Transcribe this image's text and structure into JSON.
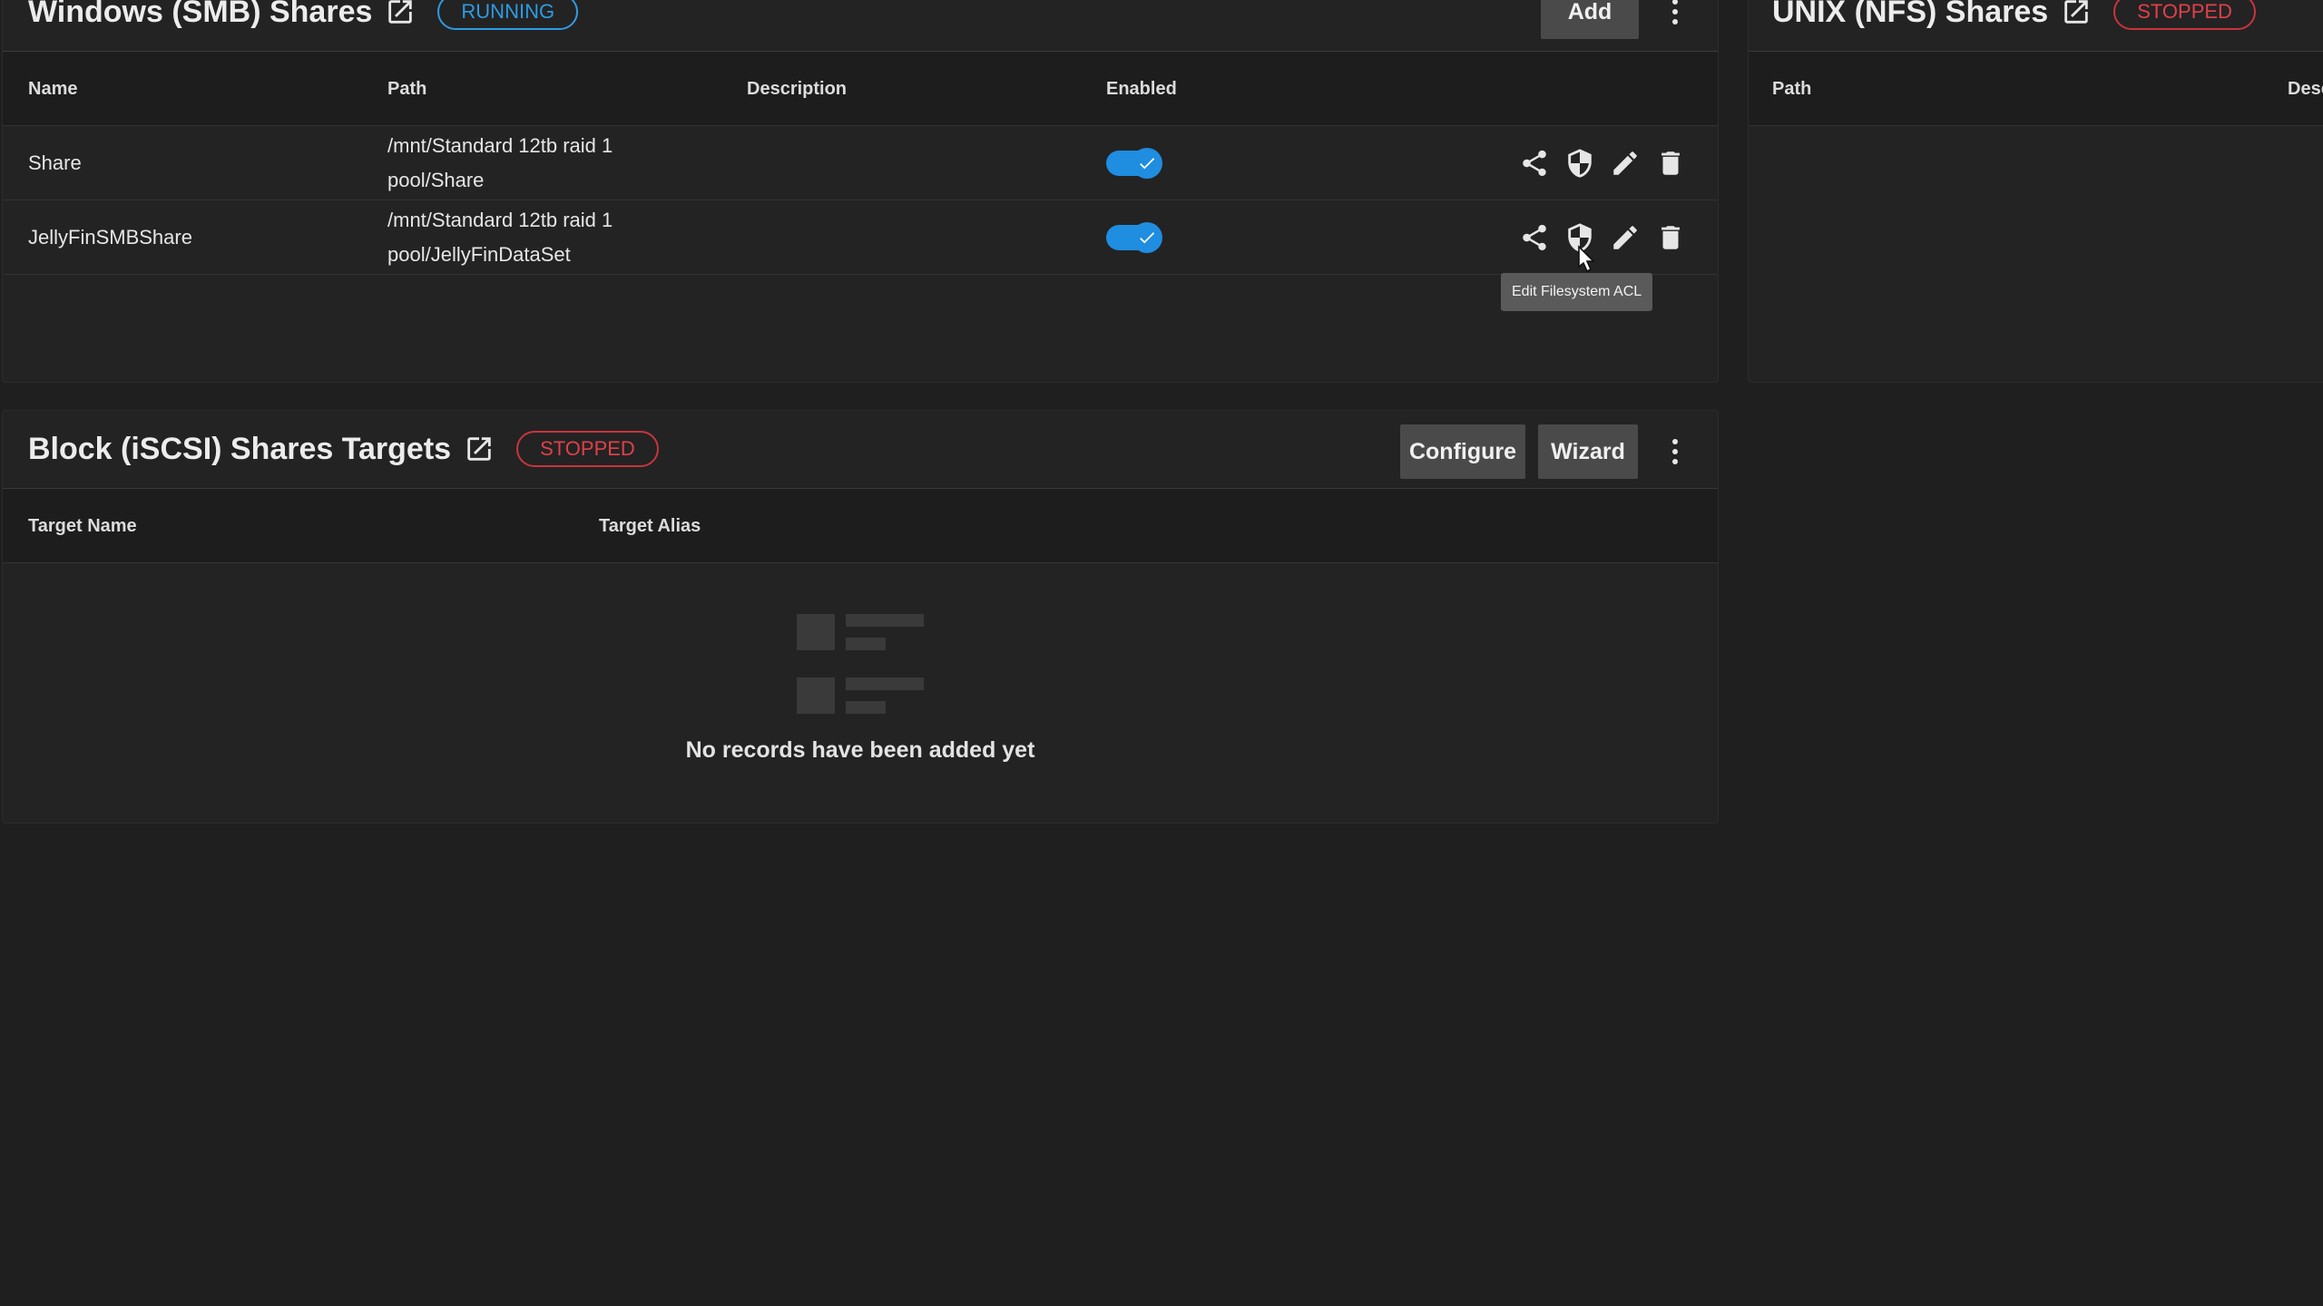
{
  "smb": {
    "title": "Windows (SMB) Shares",
    "status": "RUNNING",
    "add_label": "Add",
    "columns": [
      "Name",
      "Path",
      "Description",
      "Enabled"
    ],
    "rows": [
      {
        "name": "Share",
        "path_line1": "/mnt/Standard 12tb raid 1",
        "path_line2": "pool/Share",
        "description": "",
        "enabled": true
      },
      {
        "name": "JellyFinSMBShare",
        "path_line1": "/mnt/Standard 12tb raid 1",
        "path_line2": "pool/JellyFinDataSet",
        "description": "",
        "enabled": true
      }
    ],
    "tooltip": "Edit Filesystem ACL"
  },
  "nfs": {
    "title": "UNIX (NFS) Shares",
    "status": "STOPPED",
    "columns": [
      "Path",
      "Desc"
    ]
  },
  "iscsi": {
    "title": "Block (iSCSI) Shares Targets",
    "status": "STOPPED",
    "configure_label": "Configure",
    "wizard_label": "Wizard",
    "columns": [
      "Target Name",
      "Target Alias"
    ],
    "empty_message": "No records have been added yet"
  },
  "colors": {
    "background": "#1f1f1f",
    "card": "#232323",
    "running": "#2e9be3",
    "stopped": "#e0404a",
    "toggle": "#1f8de0"
  },
  "icons": [
    "open-in-new-icon",
    "more-vert-icon",
    "share-icon",
    "security-icon",
    "edit-icon",
    "delete-icon",
    "check-icon",
    "table-placeholder-icon",
    "mouse-pointer-icon"
  ]
}
